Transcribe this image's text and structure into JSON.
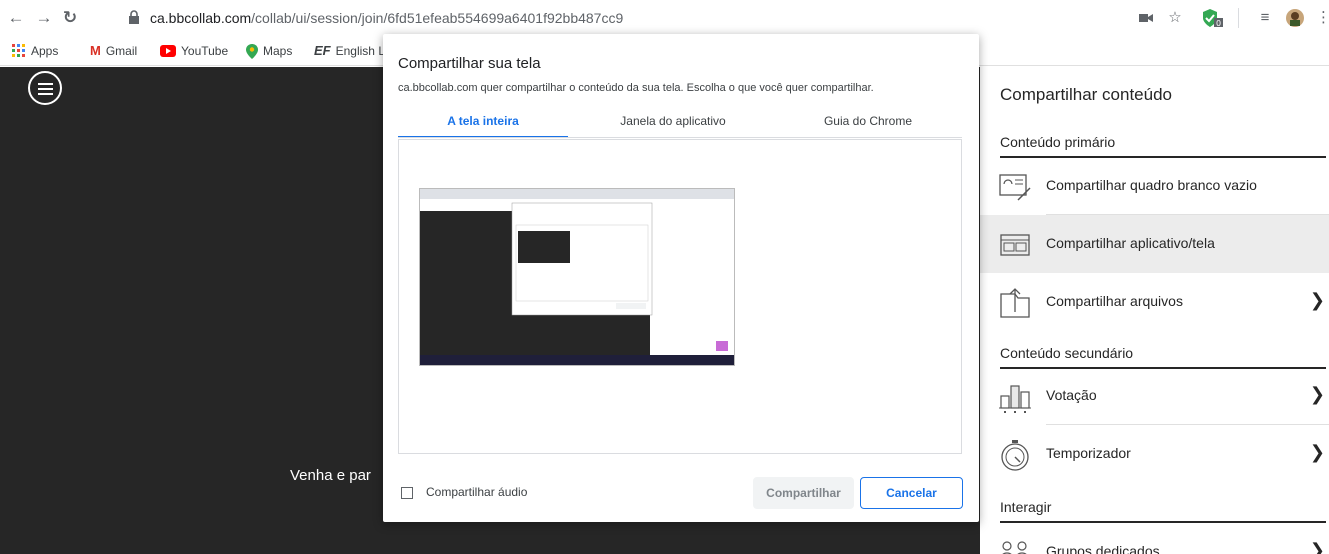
{
  "browser": {
    "url_domain": "ca.bbcollab.com",
    "url_path": "/collab/ui/session/join/6fd51efeab554699a6401f92bb487cc9",
    "bookmarks": [
      "Apps",
      "Gmail",
      "YouTube",
      "Maps",
      "English L"
    ]
  },
  "session": {
    "text": "Venha e par"
  },
  "dialog": {
    "title": "Compartilhar sua tela",
    "subtitle": "ca.bbcollab.com quer compartilhar o conteúdo da sua tela. Escolha o que você quer compartilhar.",
    "tabs": [
      "A tela inteira",
      "Janela do aplicativo",
      "Guia do Chrome"
    ],
    "active_tab": "A tela inteira",
    "audio_label": "Compartilhar áudio",
    "share_button": "Compartilhar",
    "cancel_button": "Cancelar"
  },
  "panel": {
    "title": "Compartilhar conteúdo",
    "primary_header": "Conteúdo primário",
    "primary_items": [
      "Compartilhar quadro branco vazio",
      "Compartilhar aplicativo/tela",
      "Compartilhar arquivos"
    ],
    "secondary_header": "Conteúdo secundário",
    "secondary_items": [
      "Votação",
      "Temporizador"
    ],
    "interact_header": "Interagir",
    "interact_items": [
      "Grupos dedicados"
    ]
  },
  "colors": {
    "accent": "#1a73e8",
    "session_bg": "#262626",
    "active_row": "#ececec"
  }
}
